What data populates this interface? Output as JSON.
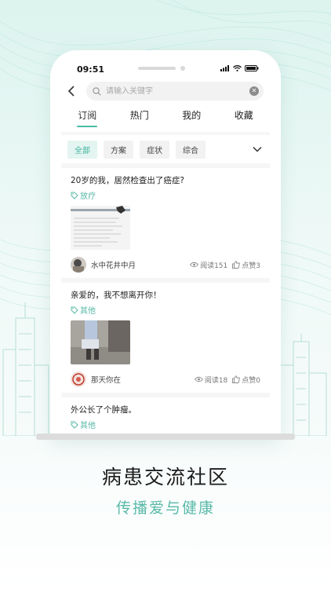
{
  "colors": {
    "accent": "#4bbba7",
    "tag": "#58b9a7",
    "background": "#dcf3ee"
  },
  "status_bar": {
    "time": "09:51"
  },
  "search": {
    "placeholder": "请输入关键字"
  },
  "tabs": [
    {
      "label": "订阅",
      "active": true
    },
    {
      "label": "热门",
      "active": false
    },
    {
      "label": "我的",
      "active": false
    },
    {
      "label": "收藏",
      "active": false
    }
  ],
  "filters": [
    {
      "label": "全部",
      "active": true
    },
    {
      "label": "方案",
      "active": false
    },
    {
      "label": "症状",
      "active": false
    },
    {
      "label": "综合",
      "active": false
    }
  ],
  "posts": [
    {
      "title": "20岁的我，居然检查出了癌症?",
      "tag": "放疗",
      "author": "水中花井中月",
      "reads": "阅读151",
      "likes": "点赞3"
    },
    {
      "title": "亲爱的，我不想离开你！",
      "tag": "其他",
      "author": "那天你在",
      "reads": "阅读18",
      "likes": "点赞0"
    },
    {
      "title": "外公长了个肿瘤。",
      "tag": "其他"
    }
  ],
  "promo": {
    "heading": "病患交流社区",
    "subheading": "传播爱与健康"
  }
}
